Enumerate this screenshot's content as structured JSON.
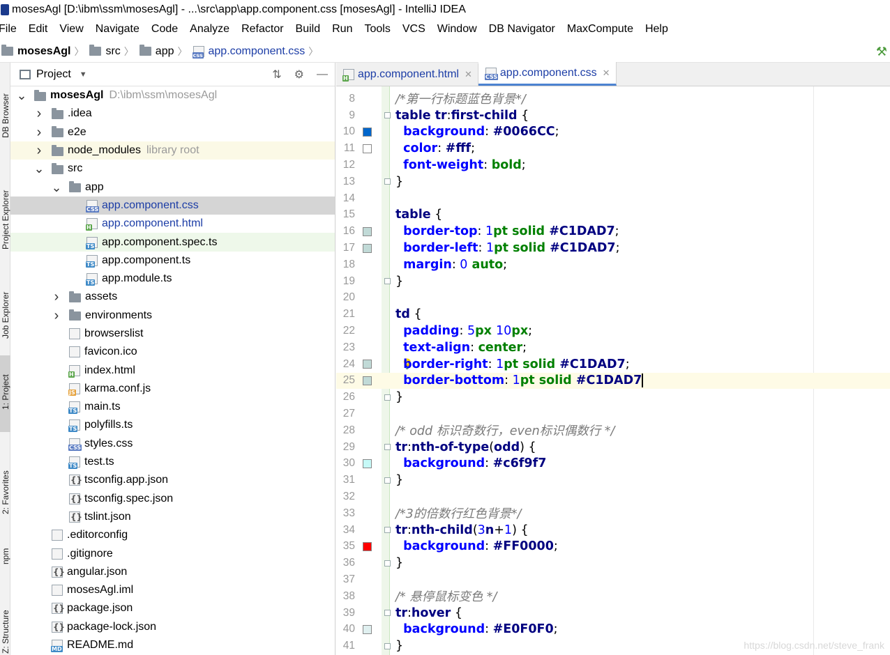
{
  "window": {
    "title": "mosesAgl [D:\\ibm\\ssm\\mosesAgl] - ...\\src\\app\\app.component.css [mosesAgl] - IntelliJ IDEA"
  },
  "menu": [
    "File",
    "Edit",
    "View",
    "Navigate",
    "Code",
    "Analyze",
    "Refactor",
    "Build",
    "Run",
    "Tools",
    "VCS",
    "Window",
    "DB Navigator",
    "MaxCompute",
    "Help"
  ],
  "breadcrumb": {
    "root": "mosesAgl",
    "src": "src",
    "app": "app",
    "file": "app.component.css",
    "file_badge": "css"
  },
  "toolstrip": {
    "db_browser": "DB Browser",
    "project_explorer": "Project Explorer",
    "job_explorer": "Job Explorer",
    "project": "1: Project",
    "favorites": "2: Favorites",
    "npm": "npm",
    "structure": "Z: Structure"
  },
  "project_panel": {
    "title": "Project"
  },
  "tree": [
    {
      "depth": 0,
      "arrow": "down",
      "icon": "folder",
      "name": "mosesAgl",
      "hint": "D:\\ibm\\ssm\\mosesAgl",
      "bold": true
    },
    {
      "depth": 1,
      "arrow": "right",
      "icon": "folder",
      "name": ".idea"
    },
    {
      "depth": 1,
      "arrow": "right",
      "icon": "folder",
      "name": "e2e"
    },
    {
      "depth": 1,
      "arrow": "right",
      "icon": "folder",
      "name": "node_modules",
      "hint": "library root",
      "style": "lib"
    },
    {
      "depth": 1,
      "arrow": "down",
      "icon": "folder",
      "name": "src"
    },
    {
      "depth": 2,
      "arrow": "down",
      "icon": "folder",
      "name": "app"
    },
    {
      "depth": 3,
      "icon": "file",
      "badge": "CSS",
      "badge_class": "css",
      "name": "app.component.css",
      "blue": true,
      "style": "selected"
    },
    {
      "depth": 3,
      "icon": "file",
      "badge": "H",
      "badge_class": "html",
      "name": "app.component.html",
      "blue": true
    },
    {
      "depth": 3,
      "icon": "file",
      "badge": "TS",
      "badge_class": "ts",
      "name": "app.component.spec.ts",
      "style": "spec"
    },
    {
      "depth": 3,
      "icon": "file",
      "badge": "TS",
      "badge_class": "ts",
      "name": "app.component.ts"
    },
    {
      "depth": 3,
      "icon": "file",
      "badge": "TS",
      "badge_class": "ts",
      "name": "app.module.ts"
    },
    {
      "depth": 2,
      "arrow": "right",
      "icon": "folder",
      "name": "assets"
    },
    {
      "depth": 2,
      "arrow": "right",
      "icon": "folder",
      "name": "environments"
    },
    {
      "depth": 2,
      "icon": "file",
      "name": "browserslist"
    },
    {
      "depth": 2,
      "icon": "file",
      "name": "favicon.ico"
    },
    {
      "depth": 2,
      "icon": "file",
      "badge": "H",
      "badge_class": "html",
      "name": "index.html"
    },
    {
      "depth": 2,
      "icon": "file",
      "badge": "JS",
      "badge_class": "js",
      "name": "karma.conf.js"
    },
    {
      "depth": 2,
      "icon": "file",
      "badge": "TS",
      "badge_class": "ts",
      "name": "main.ts"
    },
    {
      "depth": 2,
      "icon": "file",
      "badge": "TS",
      "badge_class": "ts",
      "name": "polyfills.ts"
    },
    {
      "depth": 2,
      "icon": "file",
      "badge": "CSS",
      "badge_class": "css",
      "name": "styles.css"
    },
    {
      "depth": 2,
      "icon": "file",
      "badge": "TS",
      "badge_class": "ts",
      "name": "test.ts"
    },
    {
      "depth": 2,
      "icon": "file",
      "badge": "{}",
      "badge_class": "json",
      "name": "tsconfig.app.json"
    },
    {
      "depth": 2,
      "icon": "file",
      "badge": "{}",
      "badge_class": "json",
      "name": "tsconfig.spec.json"
    },
    {
      "depth": 2,
      "icon": "file",
      "badge": "{}",
      "badge_class": "json",
      "name": "tslint.json"
    },
    {
      "depth": 1,
      "icon": "file",
      "name": ".editorconfig"
    },
    {
      "depth": 1,
      "icon": "file",
      "name": ".gitignore"
    },
    {
      "depth": 1,
      "icon": "file",
      "badge": "{}",
      "badge_class": "json",
      "name": "angular.json"
    },
    {
      "depth": 1,
      "icon": "file",
      "name": "mosesAgl.iml"
    },
    {
      "depth": 1,
      "icon": "file",
      "badge": "{}",
      "badge_class": "json",
      "name": "package.json"
    },
    {
      "depth": 1,
      "icon": "file",
      "badge": "{}",
      "badge_class": "json",
      "name": "package-lock.json"
    },
    {
      "depth": 1,
      "icon": "file",
      "badge": "MD",
      "badge_class": "md",
      "name": "README.md"
    }
  ],
  "tabs": [
    {
      "label": "app.component.html",
      "badge": "H",
      "badge_class": "html",
      "active": false
    },
    {
      "label": "app.component.css",
      "badge": "CSS",
      "badge_class": "css",
      "active": true
    }
  ],
  "code_lines": [
    {
      "n": "8",
      "tokens": [
        [
          "c-comment",
          "/*第一行标题蓝色背景*/"
        ]
      ]
    },
    {
      "n": "9",
      "fold": true,
      "tokens": [
        [
          "c-sel",
          "table tr"
        ],
        [
          "c-punct",
          ":"
        ],
        [
          "c-sel",
          "first-child"
        ],
        [
          "c-punct",
          " {"
        ]
      ]
    },
    {
      "n": "10",
      "swatch": "#0066CC",
      "tokens": [
        [
          "c-punct",
          "  "
        ],
        [
          "c-prop",
          "background"
        ],
        [
          "c-punct",
          ": "
        ],
        [
          "c-hex",
          "#0066CC"
        ],
        [
          "c-punct",
          ";"
        ]
      ]
    },
    {
      "n": "11",
      "swatch": "#ffffff",
      "tokens": [
        [
          "c-punct",
          "  "
        ],
        [
          "c-prop",
          "color"
        ],
        [
          "c-punct",
          ": "
        ],
        [
          "c-hex",
          "#fff"
        ],
        [
          "c-punct",
          ";"
        ]
      ]
    },
    {
      "n": "12",
      "tokens": [
        [
          "c-punct",
          "  "
        ],
        [
          "c-prop",
          "font-weight"
        ],
        [
          "c-punct",
          ": "
        ],
        [
          "c-val",
          "bold"
        ],
        [
          "c-punct",
          ";"
        ]
      ]
    },
    {
      "n": "13",
      "fold": true,
      "tokens": [
        [
          "c-punct",
          "}"
        ]
      ]
    },
    {
      "n": "14",
      "tokens": []
    },
    {
      "n": "15",
      "tokens": [
        [
          "c-sel",
          "table"
        ],
        [
          "c-punct",
          " {"
        ]
      ]
    },
    {
      "n": "16",
      "swatch": "#C1DAD7",
      "tokens": [
        [
          "c-punct",
          "  "
        ],
        [
          "c-prop",
          "border-top"
        ],
        [
          "c-punct",
          ": "
        ],
        [
          "c-num",
          "1"
        ],
        [
          "c-val",
          "pt solid "
        ],
        [
          "c-hex",
          "#C1DAD7"
        ],
        [
          "c-punct",
          ";"
        ]
      ]
    },
    {
      "n": "17",
      "swatch": "#C1DAD7",
      "tokens": [
        [
          "c-punct",
          "  "
        ],
        [
          "c-prop",
          "border-left"
        ],
        [
          "c-punct",
          ": "
        ],
        [
          "c-num",
          "1"
        ],
        [
          "c-val",
          "pt solid "
        ],
        [
          "c-hex",
          "#C1DAD7"
        ],
        [
          "c-punct",
          ";"
        ]
      ]
    },
    {
      "n": "18",
      "tokens": [
        [
          "c-punct",
          "  "
        ],
        [
          "c-prop",
          "margin"
        ],
        [
          "c-punct",
          ": "
        ],
        [
          "c-num",
          "0"
        ],
        [
          "c-val",
          " auto"
        ],
        [
          "c-punct",
          ";"
        ]
      ]
    },
    {
      "n": "19",
      "fold": true,
      "tokens": [
        [
          "c-punct",
          "}"
        ]
      ]
    },
    {
      "n": "20",
      "tokens": []
    },
    {
      "n": "21",
      "tokens": [
        [
          "c-sel",
          "td"
        ],
        [
          "c-punct",
          " {"
        ]
      ]
    },
    {
      "n": "22",
      "tokens": [
        [
          "c-punct",
          "  "
        ],
        [
          "c-prop",
          "padding"
        ],
        [
          "c-punct",
          ": "
        ],
        [
          "c-num",
          "5"
        ],
        [
          "c-val",
          "px "
        ],
        [
          "c-num",
          "10"
        ],
        [
          "c-val",
          "px"
        ],
        [
          "c-punct",
          ";"
        ]
      ]
    },
    {
      "n": "23",
      "tokens": [
        [
          "c-punct",
          "  "
        ],
        [
          "c-prop",
          "text-align"
        ],
        [
          "c-punct",
          ": "
        ],
        [
          "c-val",
          "center"
        ],
        [
          "c-punct",
          ";"
        ]
      ]
    },
    {
      "n": "24",
      "swatch": "#C1DAD7",
      "bulb": true,
      "tokens": [
        [
          "c-punct",
          "  "
        ],
        [
          "c-prop",
          "border-right"
        ],
        [
          "c-punct",
          ": "
        ],
        [
          "c-num",
          "1"
        ],
        [
          "c-val",
          "pt solid "
        ],
        [
          "c-hex",
          "#C1DAD7"
        ],
        [
          "c-punct",
          ";"
        ]
      ]
    },
    {
      "n": "25",
      "swatch": "#C1DAD7",
      "current": true,
      "caret": true,
      "tokens": [
        [
          "c-punct",
          "  "
        ],
        [
          "c-prop",
          "border-bottom"
        ],
        [
          "c-punct",
          ": "
        ],
        [
          "c-num",
          "1"
        ],
        [
          "c-val",
          "pt solid "
        ],
        [
          "c-hex",
          "#C1DAD7"
        ]
      ]
    },
    {
      "n": "26",
      "fold": true,
      "tokens": [
        [
          "c-punct",
          "}"
        ]
      ]
    },
    {
      "n": "27",
      "tokens": []
    },
    {
      "n": "28",
      "tokens": [
        [
          "c-comment",
          "/* odd 标识奇数行，even标识偶数行 */"
        ]
      ]
    },
    {
      "n": "29",
      "fold": true,
      "tokens": [
        [
          "c-sel",
          "tr"
        ],
        [
          "c-punct",
          ":"
        ],
        [
          "c-sel",
          "nth-of-type"
        ],
        [
          "c-punct",
          "("
        ],
        [
          "c-sel",
          "odd"
        ],
        [
          "c-punct",
          ") {"
        ]
      ]
    },
    {
      "n": "30",
      "swatch": "#c6f9f7",
      "tokens": [
        [
          "c-punct",
          "  "
        ],
        [
          "c-prop",
          "background"
        ],
        [
          "c-punct",
          ": "
        ],
        [
          "c-hex",
          "#c6f9f7"
        ]
      ]
    },
    {
      "n": "31",
      "fold": true,
      "tokens": [
        [
          "c-punct",
          "}"
        ]
      ]
    },
    {
      "n": "32",
      "tokens": []
    },
    {
      "n": "33",
      "tokens": [
        [
          "c-comment",
          "/*3的倍数行红色背景*/"
        ]
      ]
    },
    {
      "n": "34",
      "fold": true,
      "tokens": [
        [
          "c-sel",
          "tr"
        ],
        [
          "c-punct",
          ":"
        ],
        [
          "c-sel",
          "nth-child"
        ],
        [
          "c-punct",
          "("
        ],
        [
          "c-num",
          "3"
        ],
        [
          "c-sel",
          "n"
        ],
        [
          "c-punct",
          "+"
        ],
        [
          "c-num",
          "1"
        ],
        [
          "c-punct",
          ") {"
        ]
      ]
    },
    {
      "n": "35",
      "swatch": "#FF0000",
      "tokens": [
        [
          "c-punct",
          "  "
        ],
        [
          "c-prop",
          "background"
        ],
        [
          "c-punct",
          ": "
        ],
        [
          "c-hex",
          "#FF0000"
        ],
        [
          "c-punct",
          ";"
        ]
      ]
    },
    {
      "n": "36",
      "fold": true,
      "tokens": [
        [
          "c-punct",
          "}"
        ]
      ]
    },
    {
      "n": "37",
      "tokens": []
    },
    {
      "n": "38",
      "tokens": [
        [
          "c-comment",
          "/* 悬停鼠标变色 */"
        ]
      ]
    },
    {
      "n": "39",
      "fold": true,
      "tokens": [
        [
          "c-sel",
          "tr"
        ],
        [
          "c-punct",
          ":"
        ],
        [
          "c-sel",
          "hover"
        ],
        [
          "c-punct",
          " {"
        ]
      ]
    },
    {
      "n": "40",
      "swatch": "#E0F0F0",
      "tokens": [
        [
          "c-punct",
          "  "
        ],
        [
          "c-prop",
          "background"
        ],
        [
          "c-punct",
          ": "
        ],
        [
          "c-hex",
          "#E0F0F0"
        ],
        [
          "c-punct",
          ";"
        ]
      ]
    },
    {
      "n": "41",
      "fold": true,
      "tokens": [
        [
          "c-punct",
          "}"
        ]
      ]
    }
  ],
  "watermark": "https://blog.csdn.net/steve_frank"
}
